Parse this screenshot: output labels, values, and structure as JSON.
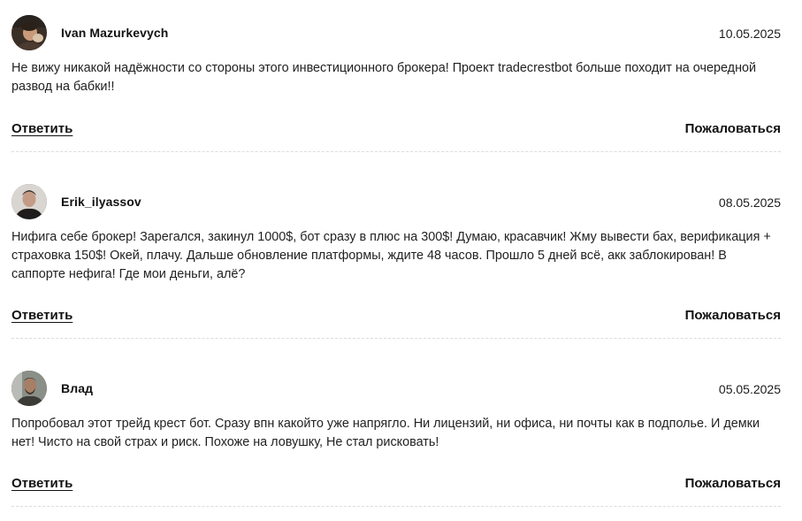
{
  "comments": [
    {
      "author": "Ivan Mazurkevych",
      "date": "10.05.2025",
      "avatar_icon": "user-avatar-photo",
      "text": "Не вижу никакой надёжности со стороны этого инвестиционного брокера! Проект tradecrestbot больше походит на очередной развод на бабки!!",
      "reply_label": "Ответить",
      "report_label": "Пожаловаться"
    },
    {
      "author": "Erik_ilyassov",
      "date": "08.05.2025",
      "avatar_icon": "user-avatar-photo",
      "text": "Нифига себе брокер! Зарегался, закинул 1000$, бот сразу в плюс на 300$! Думаю, красавчик! Жму вывести бах, верификация + страховка 150$! Окей, плачу. Дальше обновление платформы, ждите 48 часов. Прошло 5 дней всё, акк заблокирован! В саппорте нефига! Где мои деньги, алё?",
      "reply_label": "Ответить",
      "report_label": "Пожаловаться"
    },
    {
      "author": "Влад",
      "date": "05.05.2025",
      "avatar_icon": "user-avatar-photo",
      "text": "Попробовал этот трейд крест бот. Сразу впн какойто уже напрягло. Ни лицензий, ни офиса, ни почты как в подполье. И демки нет! Чисто на свой страх и риск. Похоже на ловушку, Не стал рисковать!",
      "reply_label": "Ответить",
      "report_label": "Пожаловаться"
    }
  ]
}
